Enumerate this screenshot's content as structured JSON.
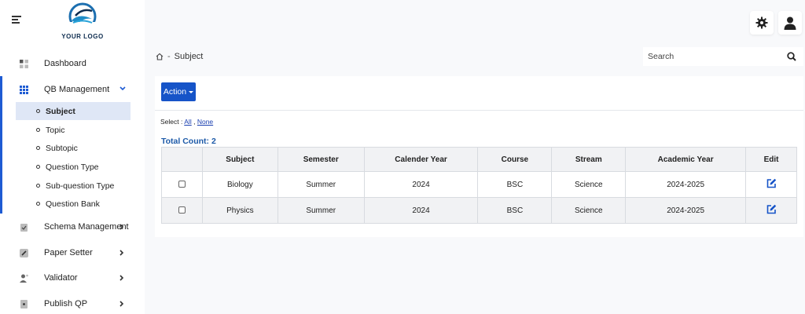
{
  "logo": {
    "text": "YOUR LOGO"
  },
  "sidebar": {
    "items": [
      {
        "label": "Dashboard",
        "icon": "dashboard-icon"
      },
      {
        "label": "QB Management",
        "icon": "grid-icon"
      },
      {
        "label": "Schema Management",
        "icon": "clipboard-icon"
      },
      {
        "label": "Paper Setter",
        "icon": "pen-icon"
      },
      {
        "label": "Validator",
        "icon": "user-plus-icon"
      },
      {
        "label": "Publish QP",
        "icon": "file-icon"
      }
    ],
    "subitems": [
      {
        "label": "Subject"
      },
      {
        "label": "Topic"
      },
      {
        "label": "Subtopic"
      },
      {
        "label": "Question Type"
      },
      {
        "label": "Sub-question Type"
      },
      {
        "label": "Question Bank"
      }
    ]
  },
  "header": {
    "settings_icon": "gear-icon",
    "user_icon": "user-icon"
  },
  "breadcrumb": {
    "separator": "-",
    "current": "Subject"
  },
  "search": {
    "placeholder": "Search",
    "value": ""
  },
  "toolbar": {
    "action_label": "Action"
  },
  "select": {
    "label": "Select :",
    "all": "All",
    "comma": ",",
    "none": "None"
  },
  "summary": {
    "total_count": "Total Count: 2"
  },
  "table": {
    "headers": [
      "",
      "Subject",
      "Semester",
      "Calender Year",
      "Course",
      "Stream",
      "Academic Year",
      "Edit"
    ],
    "rows": [
      {
        "subject": "Biology",
        "semester": "Summer",
        "year": "2024",
        "course": "BSC",
        "stream": "Science",
        "academic_year": "2024-2025"
      },
      {
        "subject": "Physics",
        "semester": "Summer",
        "year": "2024",
        "course": "BSC",
        "stream": "Science",
        "academic_year": "2024-2025"
      }
    ]
  },
  "colors": {
    "primary": "#1654c8",
    "accent_bar": "#1e5bd3",
    "total_text": "#1d5aa8",
    "active_bg": "#dfe7f6"
  }
}
